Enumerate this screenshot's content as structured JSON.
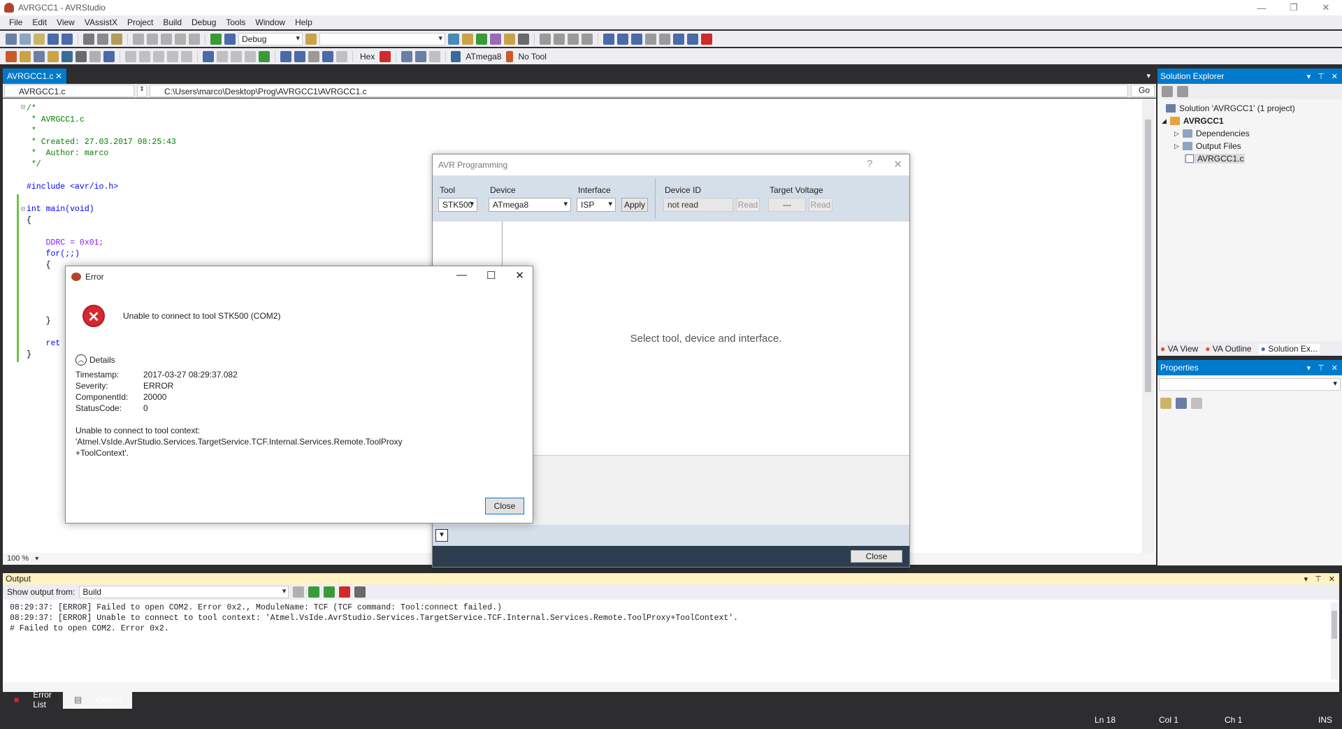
{
  "window": {
    "title": "AVRGCC1 - AVRStudio"
  },
  "menu": [
    "File",
    "Edit",
    "View",
    "VAssistX",
    "Project",
    "Build",
    "Debug",
    "Tools",
    "Window",
    "Help"
  ],
  "toolbar": {
    "config": "Debug",
    "search_value": "",
    "hex_label": "Hex",
    "device_label": "ATmega8",
    "tool_label": "No Tool"
  },
  "editor": {
    "tab_label": "AVRGCC1.c",
    "nav_file": "AVRGCC1.c",
    "nav_path": "C:\\Users\\marco\\Desktop\\Prog\\AVRGCC1\\AVRGCC1.c",
    "go_label": "Go",
    "zoom": "100 %",
    "lines": [
      "/*",
      " * AVRGCC1.c",
      " *",
      " * Created: 27.03.2017 08:25:43",
      " *  Author: marco",
      " */",
      "",
      "#include <avr/io.h>",
      "",
      "int main(void)",
      "{",
      "",
      "    DDRC = 0x01;",
      "    for(;;)",
      "    {",
      "",
      "",
      "",
      "    }",
      "",
      "    ret",
      "}"
    ]
  },
  "solution_explorer": {
    "title": "Solution Explorer",
    "solution": "Solution 'AVRGCC1' (1 project)",
    "project": "AVRGCC1",
    "items": [
      "Dependencies",
      "Output Files",
      "AVRGCC1.c"
    ],
    "tabs": [
      "VA View",
      "VA Outline",
      "Solution Ex..."
    ]
  },
  "properties": {
    "title": "Properties"
  },
  "output": {
    "title": "Output",
    "show_from_label": "Show output from:",
    "source": "Build",
    "lines": [
      "08:29:37: [ERROR] Failed to open COM2. Error 0x2., ModuleName: TCF (TCF command: Tool:connect failed.)",
      "08:29:37: [ERROR] Unable to connect to tool context: 'Atmel.VsIde.AvrStudio.Services.TargetService.TCF.Internal.Services.Remote.ToolProxy+ToolContext'.",
      "# Failed to open COM2. Error 0x2."
    ],
    "tabs": [
      "Error List",
      "Output"
    ]
  },
  "statusbar": {
    "line": "Ln 18",
    "col": "Col 1",
    "ch": "Ch 1",
    "mode": "INS"
  },
  "avr_dialog": {
    "title": "AVR Programming",
    "help": "?",
    "tool_label": "Tool",
    "tool_value": "STK500",
    "device_label": "Device",
    "device_value": "ATmega8",
    "interface_label": "Interface",
    "interface_value": "ISP",
    "apply": "Apply",
    "device_id_label": "Device ID",
    "device_id_value": "not read",
    "read": "Read",
    "voltage_label": "Target Voltage",
    "voltage_value": "---",
    "message": "Select tool, device and interface.",
    "close": "Close"
  },
  "error_dialog": {
    "title": "Error",
    "message": "Unable to connect to tool STK500 (COM2)",
    "details_label": "Details",
    "fields": [
      {
        "key": "Timestamp:",
        "value": "2017-03-27 08:29:37.082"
      },
      {
        "key": "Severity:",
        "value": "ERROR"
      },
      {
        "key": "ComponentId:",
        "value": "20000"
      },
      {
        "key": "StatusCode:",
        "value": "0"
      }
    ],
    "context_line1": "Unable to connect to tool context: 'Atmel.VsIde.AvrStudio.Services.TargetService.TCF.Internal.Services.Remote.ToolProxy",
    "context_line2": "+ToolContext'.",
    "close": "Close"
  }
}
